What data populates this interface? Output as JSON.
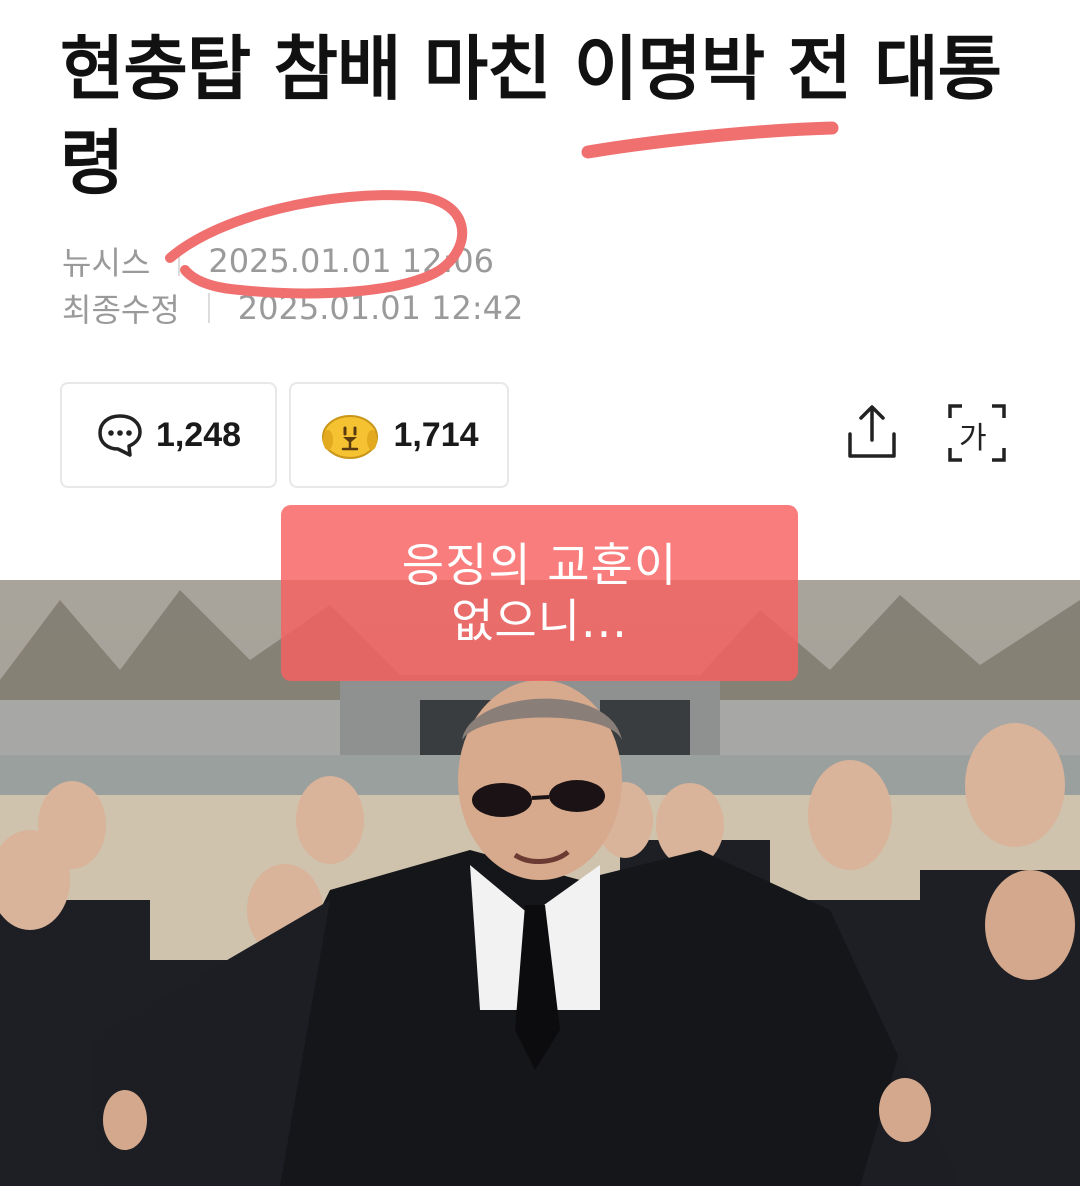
{
  "article": {
    "headline": "현충탑 참배 마친 이명박 전 대통령",
    "source": "뉴시스",
    "published": "2025.01.01 12:06",
    "modified_label": "최종수정",
    "modified": "2025.01.01 12:42"
  },
  "stats": {
    "comments_count": "1,248",
    "reactions_count": "1,714"
  },
  "toolbar": {
    "share_icon": "share-icon",
    "font_size_icon": "font-size-icon",
    "font_size_glyph": "가"
  },
  "overlay": {
    "line1": "응징의 교훈이",
    "line2": "없으니..."
  },
  "colors": {
    "annotation_red": "#f07070",
    "overlay_bg": "#f86060",
    "reaction_yellow": "#f5c232"
  }
}
